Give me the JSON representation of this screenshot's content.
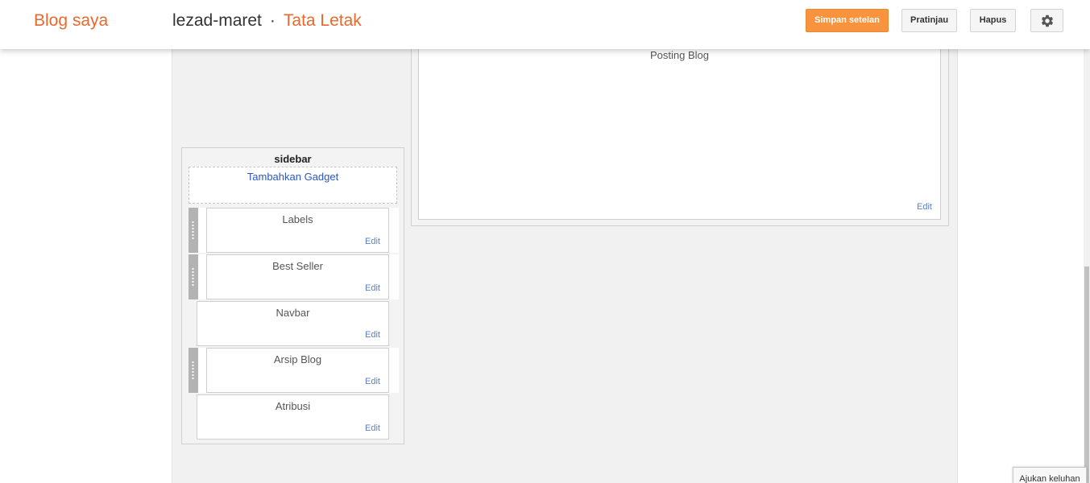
{
  "header": {
    "brand": "Blog saya",
    "blog_name": "lezad-maret",
    "separator": "·",
    "page_name": "Tata Letak",
    "buttons": {
      "save": "Simpan setelan",
      "preview": "Pratinjau",
      "delete": "Hapus"
    },
    "settings_icon": "gear-icon"
  },
  "main": {
    "widget_title": "Posting Blog",
    "edit_label": "Edit"
  },
  "sidebar": {
    "title": "sidebar",
    "add_gadget": "Tambahkan Gadget",
    "widgets": [
      {
        "name": "Labels",
        "edit": "Edit",
        "movable": true
      },
      {
        "name": "Best Seller",
        "edit": "Edit",
        "movable": true
      },
      {
        "name": "Navbar",
        "edit": "Edit",
        "movable": false
      },
      {
        "name": "Arsip Blog",
        "edit": "Edit",
        "movable": true
      },
      {
        "name": "Atribusi",
        "edit": "Edit",
        "movable": false
      }
    ]
  },
  "footer": {
    "feedback": "Ajukan keluhan"
  },
  "colors": {
    "accent": "#e8692b",
    "save_button": "#f9933e",
    "link": "#2a56c6",
    "edit_link": "#5b7fc4"
  }
}
